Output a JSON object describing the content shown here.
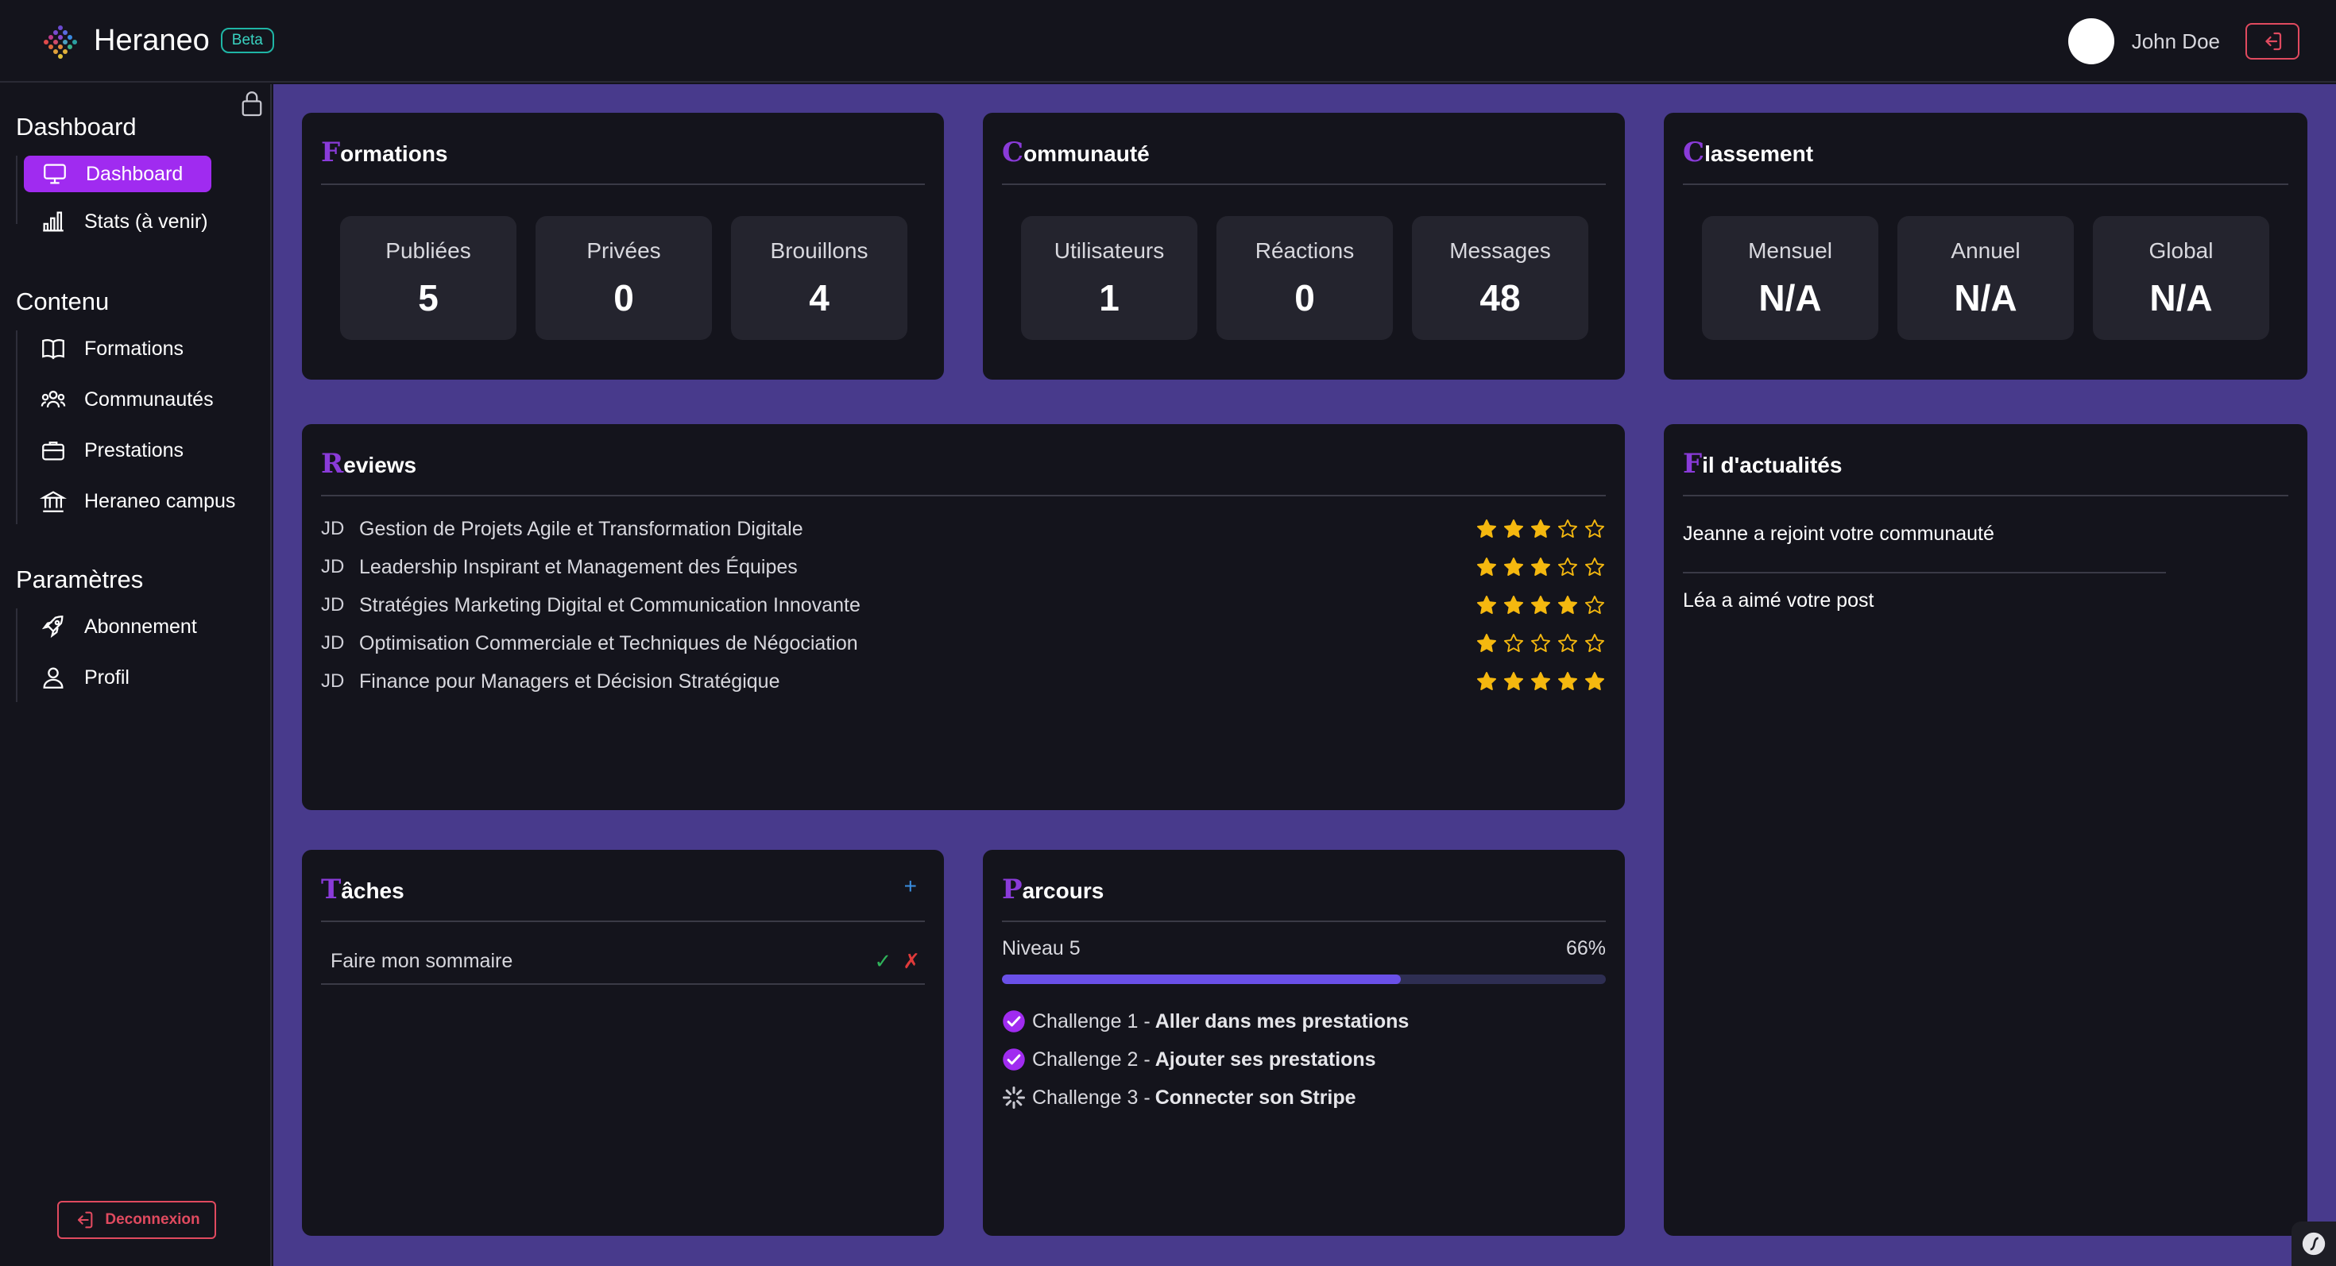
{
  "header": {
    "brand_name": "Heraneo",
    "beta_label": "Beta",
    "user_name": "John Doe"
  },
  "sidebar": {
    "sections": [
      {
        "title": "Dashboard",
        "items": [
          {
            "label": "Dashboard",
            "icon": "monitor-icon",
            "active": true
          },
          {
            "label": "Stats (à venir)",
            "icon": "bar-chart-icon"
          }
        ]
      },
      {
        "title": "Contenu",
        "items": [
          {
            "label": "Formations",
            "icon": "book-icon"
          },
          {
            "label": "Communautés",
            "icon": "users-icon"
          },
          {
            "label": "Prestations",
            "icon": "briefcase-icon"
          },
          {
            "label": "Heraneo campus",
            "icon": "bank-icon"
          }
        ]
      },
      {
        "title": "Paramètres",
        "items": [
          {
            "label": "Abonnement",
            "icon": "rocket-icon"
          },
          {
            "label": "Profil",
            "icon": "user-icon"
          }
        ]
      }
    ],
    "logout_label": "Deconnexion"
  },
  "formations": {
    "title_first": "F",
    "title_rest": "ormations",
    "stats": [
      {
        "label": "Publiées",
        "value": "5"
      },
      {
        "label": "Privées",
        "value": "0"
      },
      {
        "label": "Brouillons",
        "value": "4"
      }
    ]
  },
  "communaute": {
    "title_first": "C",
    "title_rest": "ommunauté",
    "stats": [
      {
        "label": "Utilisateurs",
        "value": "1"
      },
      {
        "label": "Réactions",
        "value": "0"
      },
      {
        "label": "Messages",
        "value": "48"
      }
    ]
  },
  "classement": {
    "title_first": "C",
    "title_rest": "lassement",
    "stats": [
      {
        "label": "Mensuel",
        "value": "N/A"
      },
      {
        "label": "Annuel",
        "value": "N/A"
      },
      {
        "label": "Global",
        "value": "N/A"
      }
    ]
  },
  "reviews": {
    "title_first": "R",
    "title_rest": "eviews",
    "items": [
      {
        "initials": "JD",
        "title": "Gestion de Projets Agile et Transformation Digitale",
        "rating": 3
      },
      {
        "initials": "JD",
        "title": "Leadership Inspirant et Management des Équipes",
        "rating": 3
      },
      {
        "initials": "JD",
        "title": "Stratégies Marketing Digital et Communication Innovante",
        "rating": 4
      },
      {
        "initials": "JD",
        "title": "Optimisation Commerciale et Techniques de Négociation",
        "rating": 1
      },
      {
        "initials": "JD",
        "title": "Finance pour Managers et Décision Stratégique",
        "rating": 5
      }
    ],
    "max_rating": 5
  },
  "news": {
    "title_first": "F",
    "title_rest": "il d'actualités",
    "items": [
      "Jeanne a rejoint votre communauté",
      "Léa a aimé votre post"
    ]
  },
  "tasks": {
    "title_first": "T",
    "title_rest": "âches",
    "add_label": "+",
    "items": [
      {
        "text": "Faire mon sommaire",
        "ok_label": "✓",
        "no_label": "✗"
      }
    ]
  },
  "parcours": {
    "title_first": "P",
    "title_rest": "arcours",
    "level_label": "Niveau 5",
    "progress_label": "66%",
    "progress": 0.66,
    "challenges": [
      {
        "prefix": "Challenge 1 -",
        "name": "Aller dans mes prestations",
        "done": true
      },
      {
        "prefix": "Challenge 2 -",
        "name": "Ajouter ses prestations",
        "done": true
      },
      {
        "prefix": "Challenge 3 -",
        "name": "Connecter son Stripe",
        "done": false
      }
    ]
  },
  "colors": {
    "accent": "#a02bf0",
    "background": "#483a8c",
    "card": "#14141c",
    "star": "#f5b80f",
    "danger": "#e04a5f",
    "progress": "#6a50e8"
  }
}
